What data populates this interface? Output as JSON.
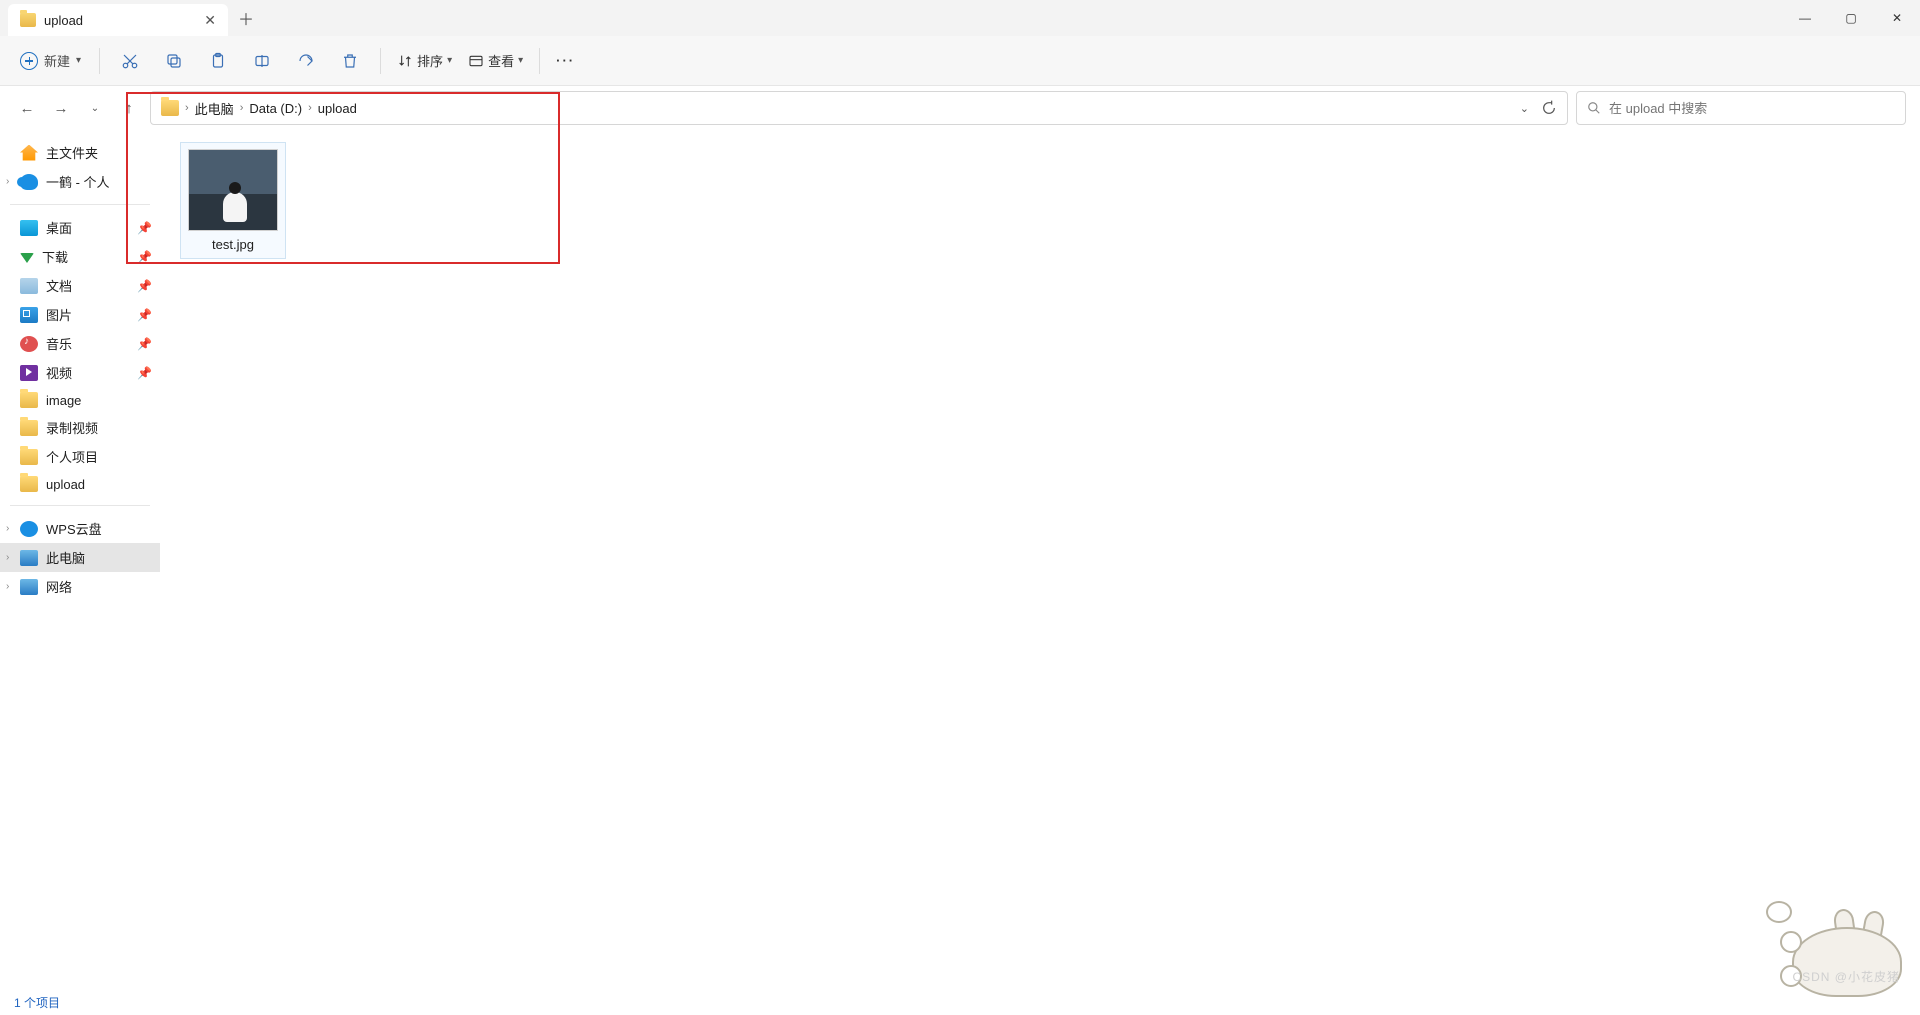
{
  "tab": {
    "title": "upload"
  },
  "toolbar": {
    "new_label": "新建",
    "sort_label": "排序",
    "view_label": "查看"
  },
  "breadcrumb": {
    "items": [
      "此电脑",
      "Data (D:)",
      "upload"
    ]
  },
  "search": {
    "placeholder": "在 upload 中搜索"
  },
  "sidebar": {
    "home": "主文件夹",
    "onedrive": "一鹤 - 个人",
    "quick": [
      {
        "label": "桌面",
        "icon": "desk"
      },
      {
        "label": "下载",
        "icon": "down"
      },
      {
        "label": "文档",
        "icon": "doc"
      },
      {
        "label": "图片",
        "icon": "pic"
      },
      {
        "label": "音乐",
        "icon": "music"
      },
      {
        "label": "视频",
        "icon": "video"
      }
    ],
    "folders": [
      {
        "label": "image"
      },
      {
        "label": "录制视频"
      },
      {
        "label": "个人项目"
      },
      {
        "label": "upload"
      }
    ],
    "wps": "WPS云盘",
    "thispc": "此电脑",
    "network": "网络"
  },
  "files": [
    {
      "name": "test.jpg"
    }
  ],
  "status": {
    "count_label": "1 个项目"
  },
  "watermark": "CSDN @小花皮猪"
}
